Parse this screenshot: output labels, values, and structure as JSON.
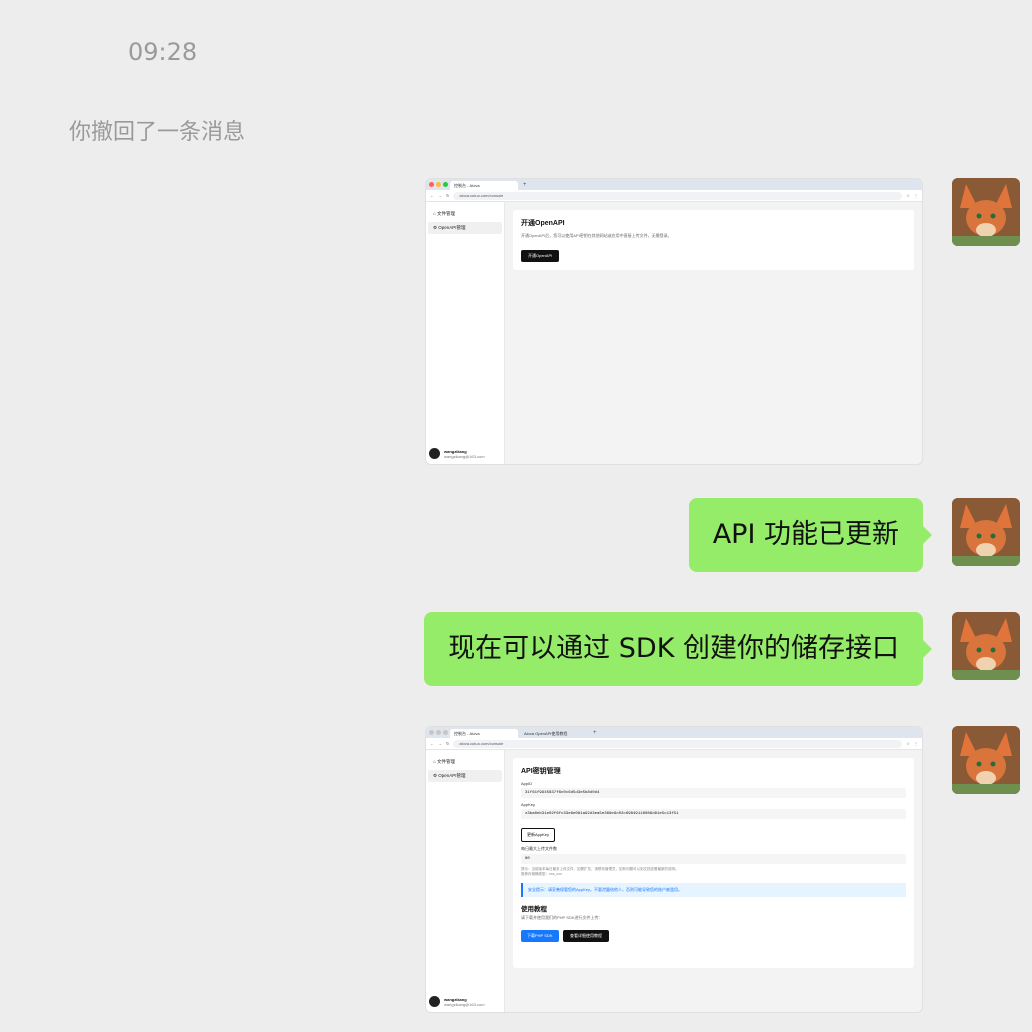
{
  "chat": {
    "time": "09:28",
    "recall_notice": "你撤回了一条消息",
    "messages": [
      "API 功能已更新",
      "现在可以通过 SDK 创建你的储存接口"
    ]
  },
  "shot1": {
    "tab_title": "控制台 - Alova",
    "url": "alova.cutuo.com/console",
    "sidebar": [
      "文件管理",
      "OpenAPI管理"
    ],
    "user_name": "wangzikang",
    "user_email": "wangzikang@163.com",
    "card_title": "开通OpenAPI",
    "card_desc": "开通OpenAPI后，您可以使用API密钥在其他网站或应用中直接上传文件，无需登录。",
    "card_button": "开通OpenAPI"
  },
  "shot2": {
    "tab_title": "控制台 - Alova",
    "tab2_title": "Alova OpenAPI使用教程",
    "url": "alova.cutuo.com/console",
    "sidebar": [
      "文件管理",
      "OpenAPI管理"
    ],
    "user_name": "wangzikang",
    "user_email": "wangzikang@163.com",
    "card_title": "API密钥管理",
    "appid_label": "AppID",
    "appid_value": "31f61f9945837f6c0c6d5d3e5b8d0d4",
    "appkey_label": "AppKey",
    "appkey_value": "z3ba0eb31e02f6fc33e6e081a92d3ea5e369e9c02c69849118086d91e5c13f51",
    "update_button": "更新AppKey",
    "limit_label": "每日最大上传文件数",
    "limit_value": "80",
    "hint_line1": "提示：当前版本每日最多上传文件，如需扩充，请联系管理员，如有问题可以到文档查看最新的说明。",
    "hint_line2": "推荐存储桶类型：oss_cos",
    "notice": "安全提示：请妥善保管您的AppKey，不要泄露给他人，否则可能导致您的账户被滥用。",
    "tutorial_title": "使用教程",
    "tutorial_desc": "请下载并使用我们的PHP SDK进行文件上传：",
    "sdk_button": "下载PHP SDK",
    "tutorial_button": "查看详细使用教程"
  },
  "colors": {
    "background": "#ededed",
    "bubble": "#95ec69",
    "accent_blue": "#1677ff"
  }
}
